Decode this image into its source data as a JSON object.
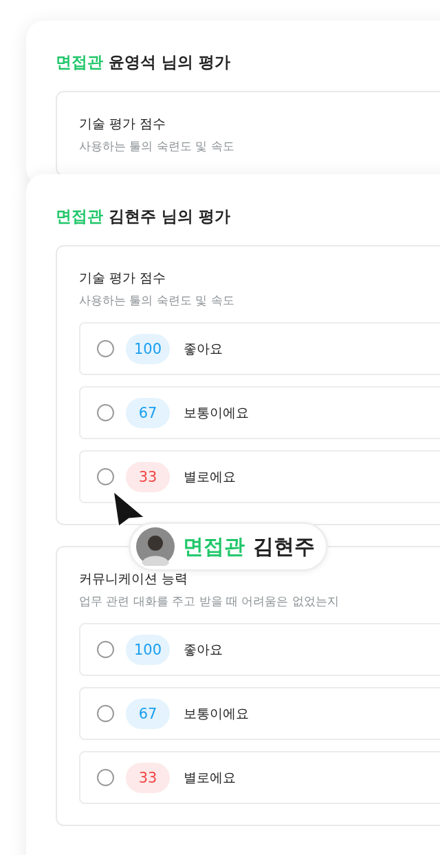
{
  "evaluations": [
    {
      "role": "면접관",
      "title": "윤영석 님의 평가",
      "sections": [
        {
          "title": "기술 평가 점수",
          "description": "사용하는 툴의 숙련도 및 속도"
        }
      ]
    },
    {
      "role": "면접관",
      "title": "김현주 님의 평가",
      "sections": [
        {
          "title": "기술 평가 점수",
          "description": "사용하는 툴의 숙련도 및 속도",
          "options": [
            {
              "score": "100",
              "label": "좋아요",
              "color": "#1a9ff0",
              "selected": false
            },
            {
              "score": "67",
              "label": "보통이에요",
              "color": "#1a9ff0",
              "selected": false
            },
            {
              "score": "33",
              "label": "별로에요",
              "color": "#f04545",
              "selected": false
            }
          ]
        },
        {
          "title": "커뮤니케이션 능력",
          "description": "업무 관련 대화를 주고 받을 때 어려움은 없었는지",
          "options": [
            {
              "score": "100",
              "label": "좋아요",
              "color": "#1a9ff0",
              "selected": false
            },
            {
              "score": "67",
              "label": "보통이에요",
              "color": "#1a9ff0",
              "selected": false
            },
            {
              "score": "33",
              "label": "별로에요",
              "color": "#f04545",
              "selected": false
            }
          ]
        }
      ]
    }
  ],
  "cursor_badge": {
    "role": "면접관",
    "name": "김현주"
  }
}
